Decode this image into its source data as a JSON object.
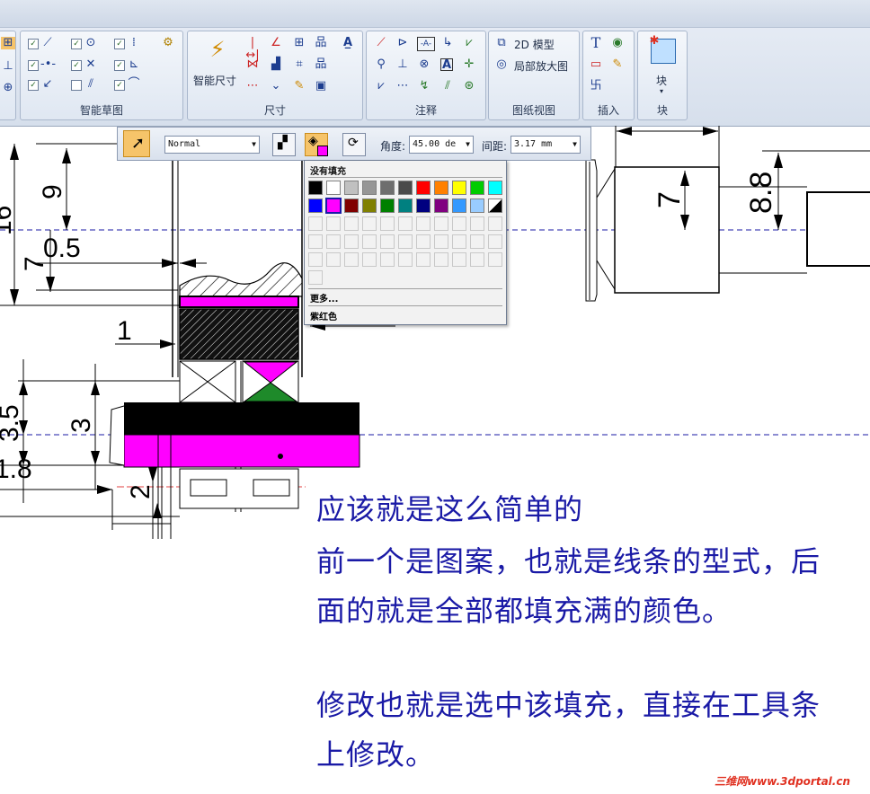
{
  "ribbon": {
    "groups": [
      {
        "label": "智能草图"
      },
      {
        "label": "尺寸"
      },
      {
        "label": "注释"
      },
      {
        "label": "图纸视图"
      },
      {
        "label": "插入"
      },
      {
        "label": "块"
      }
    ],
    "smart_dimension_label": "智能尺寸",
    "view_2d_model_label": "2D 模型",
    "detail_view_label": "局部放大图",
    "block_button_label": "块"
  },
  "command_bar": {
    "style_value": "Normal",
    "angle_label": "角度:",
    "angle_value": "45.00 de",
    "spacing_label": "间距:",
    "spacing_value": "3.17 mm"
  },
  "fill_palette": {
    "no_fill_label": "没有填充",
    "more_label": "更多...",
    "current_color_label": "紫红色",
    "colors_row1": [
      "#000000",
      "#ffffff",
      "#c0c0c0",
      "#969696",
      "#6e6e6e",
      "#4a4a4a",
      "#ff0000",
      "#ff8000",
      "#ffff00",
      "#00cc00",
      "#00ffff"
    ],
    "colors_row2": [
      "#0000ff",
      "#ff00ff",
      "#800000",
      "#808000",
      "#008000",
      "#008080",
      "#000080",
      "#800080",
      "#3399ff",
      "#99ccff",
      "diagonal"
    ],
    "selected_color": "#ff00ff"
  },
  "drawing": {
    "dimensions": [
      "9",
      "7",
      "0.5",
      "1",
      "3.5",
      "3",
      "1.8",
      "2",
      "7",
      "8.8",
      "16"
    ],
    "hatch_fill_color": "#ff00ff",
    "centerline_color": "#1a1aa6"
  },
  "note": {
    "line1": "应该就是这么简单的",
    "line2": "前一个是图案，也就是线条的型式，后",
    "line3": "面的就是全部都填充满的颜色。",
    "line4": "修改也就是选中该填充，直接在工具条",
    "line5": "上修改。"
  },
  "watermark": "三维网www.3dportal.cn"
}
